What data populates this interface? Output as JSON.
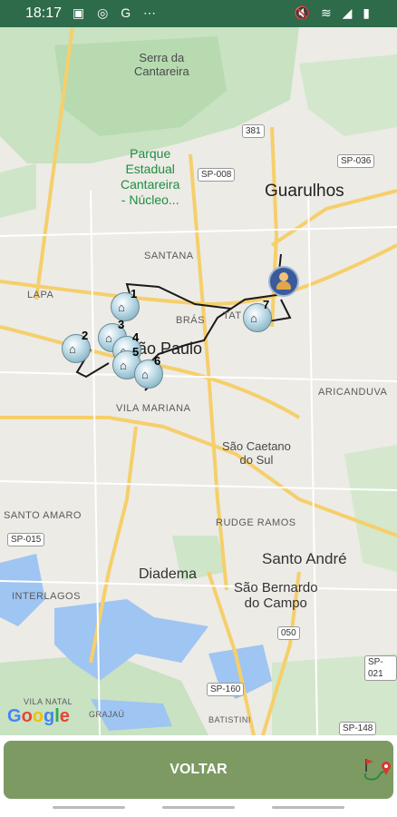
{
  "status_bar": {
    "time": "18:17",
    "left_icons": [
      "image-icon",
      "at-icon",
      "g-icon",
      "more-icon"
    ],
    "left_icons_text": "▣ ◎ G ⋯",
    "right_icons": [
      "mute-icon",
      "wifi-icon",
      "signal-icon",
      "battery-icon"
    ],
    "right_icons_text": "🔇 ≋ ◢ ▮"
  },
  "map": {
    "labels": {
      "serra": "Serra da\nCantareira",
      "parque": "Parque\nEstadual\nCantareira\n- Núcleo...",
      "guarulhos": "Guarulhos",
      "santana": "SANTANA",
      "lapa": "LAPA",
      "bras": "BRÁS",
      "tatuape": "TAT",
      "sao_paulo": "São Paulo",
      "aricanduva": "ARICANDUVA",
      "vila_mariana": "VILA MARIANA",
      "sao_caetano": "São Caetano\ndo Sul",
      "santo_amaro": "SANTO AMARO",
      "rudge_ramos": "RUDGE RAMOS",
      "santo_andre": "Santo André",
      "diadema": "Diadema",
      "sao_bernardo": "São Bernardo\ndo Campo",
      "interlagos": "INTERLAGOS",
      "vila_natal": "VILA NATAL",
      "grajau": "GRAJAÚ",
      "batistini": "BATISTINI"
    },
    "shields": {
      "sp381": "381",
      "sp008": "SP-008",
      "sp036": "SP-036",
      "sp015": "SP-015",
      "sp050": "050",
      "sp160": "SP-160",
      "sp021": "SP-021",
      "sp148": "SP-148"
    },
    "markers": [
      "1",
      "2",
      "3",
      "4",
      "5",
      "6",
      "7"
    ],
    "house_glyph": "⌂",
    "google_logo": "Google"
  },
  "action": {
    "voltar": "VOLTAR"
  },
  "colors": {
    "status_bar": "#2e6b4b",
    "button": "#7d9a63",
    "route": "#1a1a1a",
    "water": "#9fc5f2",
    "park": "#b7dab1"
  }
}
